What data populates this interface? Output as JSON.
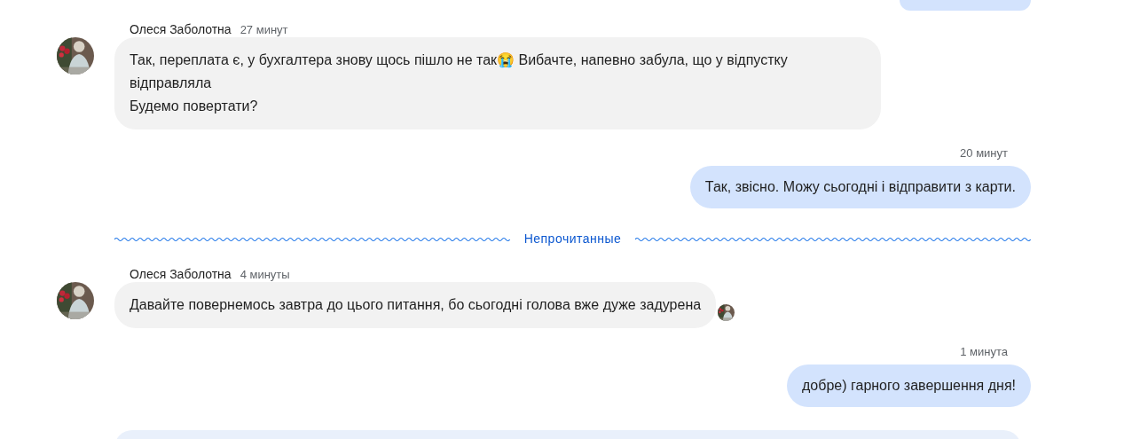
{
  "messages": [
    {
      "kind": "incoming",
      "sender": "Олеся Заболотна",
      "time": "27 минут",
      "text": "Так, переплата є, у бухгалтера знову щось пішло не так😭 Вибачте, напевно забула, що у відпустку відправляла\nБудемо повертати?",
      "read_receipt": false
    },
    {
      "kind": "outgoing",
      "time": "20 минут",
      "text": "Так, звісно. Можу сьогодні і відправити з карти."
    },
    {
      "kind": "divider",
      "label": "Непрочитанные"
    },
    {
      "kind": "incoming",
      "sender": "Олеся Заболотна",
      "time": "4 минуты",
      "text": "Давайте повернемось завтра до цього питання, бо сьогодні голова вже дуже задурена",
      "read_receipt": true
    },
    {
      "kind": "outgoing",
      "time": "1 минута",
      "text": "добре) гарного завершення дня!"
    }
  ]
}
